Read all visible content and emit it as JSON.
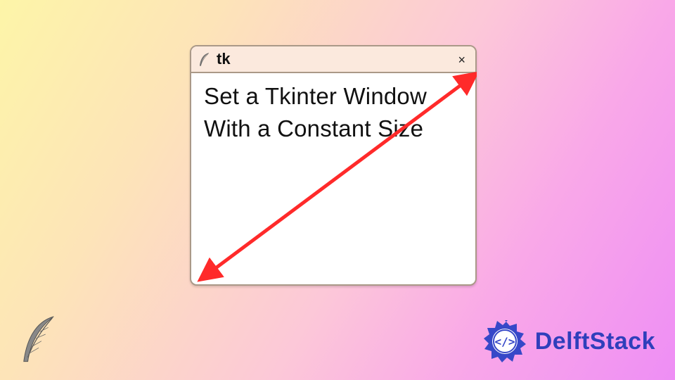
{
  "window": {
    "title": "tk",
    "close_glyph": "×",
    "body_text": "Set a Tkinter Window With a Constant Size"
  },
  "brand": {
    "name": "DelftStack"
  },
  "colors": {
    "arrow": "#ff2a2a",
    "brand": "#2f3fbb"
  }
}
